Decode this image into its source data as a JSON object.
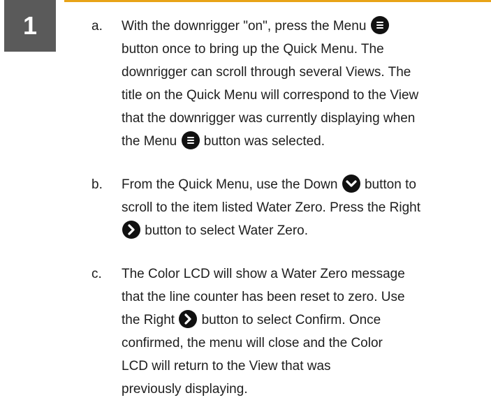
{
  "step": {
    "number": "1"
  },
  "items": {
    "a": {
      "marker": "a.",
      "l1_before": "With the downrigger \"on\", press the Menu",
      "l2": "button once to bring up the Quick Menu. The",
      "l3": "downrigger can scroll through several Views. The",
      "l4": "title on the Quick Menu will correspond to the View",
      "l5": "that the downrigger was currently displaying when",
      "l6_before": "the Menu",
      "l6_after": "button was selected."
    },
    "b": {
      "marker": "b.",
      "l1_before": "From the Quick Menu, use the Down",
      "l1_after": "button to",
      "l2": "scroll to the item listed Water Zero. Press the Right",
      "l3_after": "button to select Water Zero."
    },
    "c": {
      "marker": "c.",
      "l1": "The Color LCD will show a Water Zero message",
      "l2": "that the line counter has been reset to zero. Use",
      "l3_before": "the Right",
      "l3_after": "button to select Confirm. Once",
      "l4": "confirmed, the menu will close and the Color",
      "l5": "LCD will return to the View that was",
      "l6": "previously displaying."
    }
  },
  "icons": {
    "menu": "menu-icon",
    "down": "chevron-down-icon",
    "right": "chevron-right-icon"
  },
  "colors": {
    "accent_rule": "#e8a317",
    "badge": "#5a5a5a",
    "icon": "#111111"
  }
}
